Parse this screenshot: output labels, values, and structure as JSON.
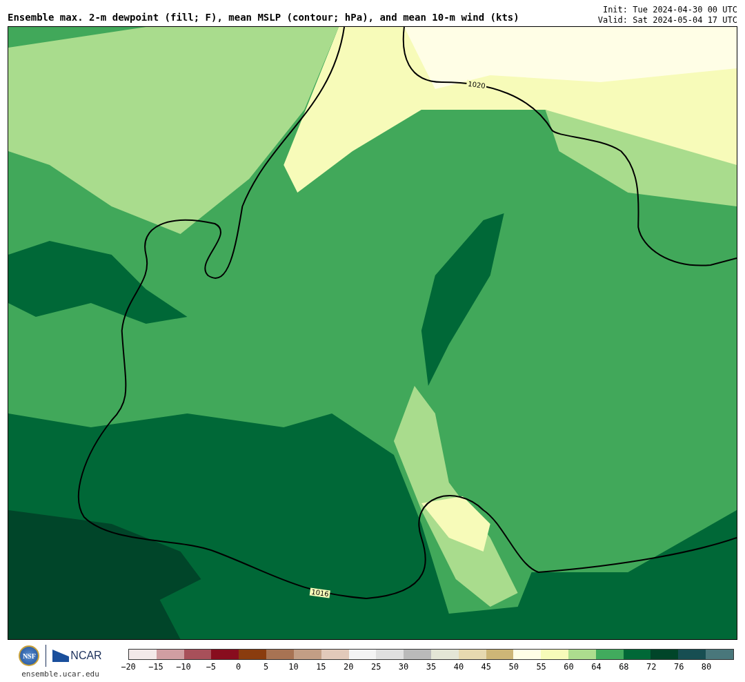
{
  "header": {
    "title": "Ensemble max. 2-m dewpoint (fill; F), mean MSLP (contour; hPa), and mean 10-m wind (kts)",
    "init": "Init: Tue 2024-04-30 00 UTC",
    "valid": "Valid: Sat 2024-05-04 17 UTC"
  },
  "map": {
    "contour_labels": [
      "1020",
      "1016"
    ]
  },
  "footer": {
    "logos": [
      {
        "kind": "seal",
        "text": "NSF"
      },
      {
        "kind": "wordmark",
        "text": "NCAR"
      }
    ],
    "url": "ensemble.ucar.edu"
  },
  "colorbar": {
    "swatches": [
      {
        "color": "#f3e9e9",
        "label": "−20"
      },
      {
        "color": "#d09ea2",
        "label": "−15"
      },
      {
        "color": "#a8505a",
        "label": "−10"
      },
      {
        "color": "#880d1e",
        "label": "−5"
      },
      {
        "color": "#8a3c0e",
        "label": "0"
      },
      {
        "color": "#a87353",
        "label": "5"
      },
      {
        "color": "#c39e85",
        "label": "10"
      },
      {
        "color": "#e2c9ba",
        "label": "15"
      },
      {
        "color": "#f4f4f4",
        "label": "20"
      },
      {
        "color": "#e0e0e0",
        "label": "25"
      },
      {
        "color": "#bababa",
        "label": "30"
      },
      {
        "color": "#e4e6d6",
        "label": "35"
      },
      {
        "color": "#e6d9b0",
        "label": "40"
      },
      {
        "color": "#cdb677",
        "label": "45"
      },
      {
        "color": "#fffee6",
        "label": "50"
      },
      {
        "color": "#f7fbb9",
        "label": "55"
      },
      {
        "color": "#addd8e",
        "label": "60"
      },
      {
        "color": "#41ab5d",
        "label": "64"
      },
      {
        "color": "#006837",
        "label": "68"
      },
      {
        "color": "#004529",
        "label": "72"
      },
      {
        "color": "#174e52",
        "label": "76"
      },
      {
        "color": "#49777b",
        "label": "80"
      }
    ]
  }
}
